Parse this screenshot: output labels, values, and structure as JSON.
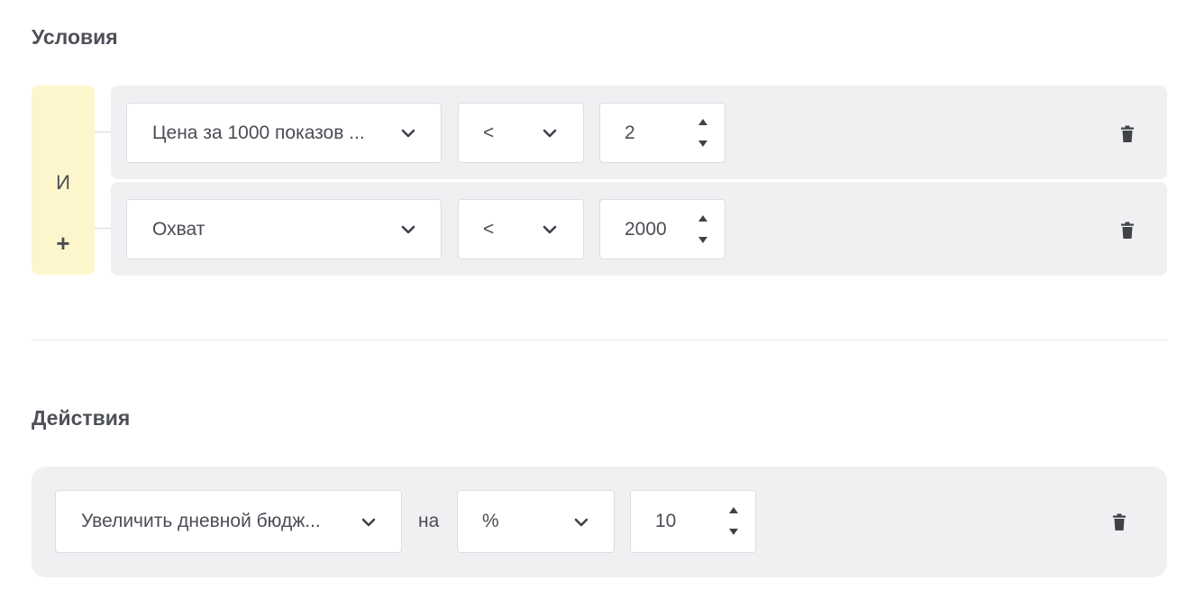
{
  "conditions": {
    "title": "Условия",
    "logic_operator": "И",
    "add_label": "+",
    "rows": [
      {
        "metric": "Цена за 1000 показов ...",
        "operator": "<",
        "value": "2"
      },
      {
        "metric": "Охват",
        "operator": "<",
        "value": "2000"
      }
    ]
  },
  "actions": {
    "title": "Действия",
    "rows": [
      {
        "action": "Увеличить дневной бюдж...",
        "connector": "на",
        "unit": "%",
        "value": "10"
      }
    ]
  },
  "icons": {
    "chevron": "chevron-down-icon",
    "spinner_up": "triangle-up-icon",
    "spinner_down": "triangle-down-icon",
    "delete": "trash-icon"
  },
  "colors": {
    "logic_box": "#fdf6cc",
    "row_background": "#f0f0f2",
    "text": "#4a4d55"
  }
}
